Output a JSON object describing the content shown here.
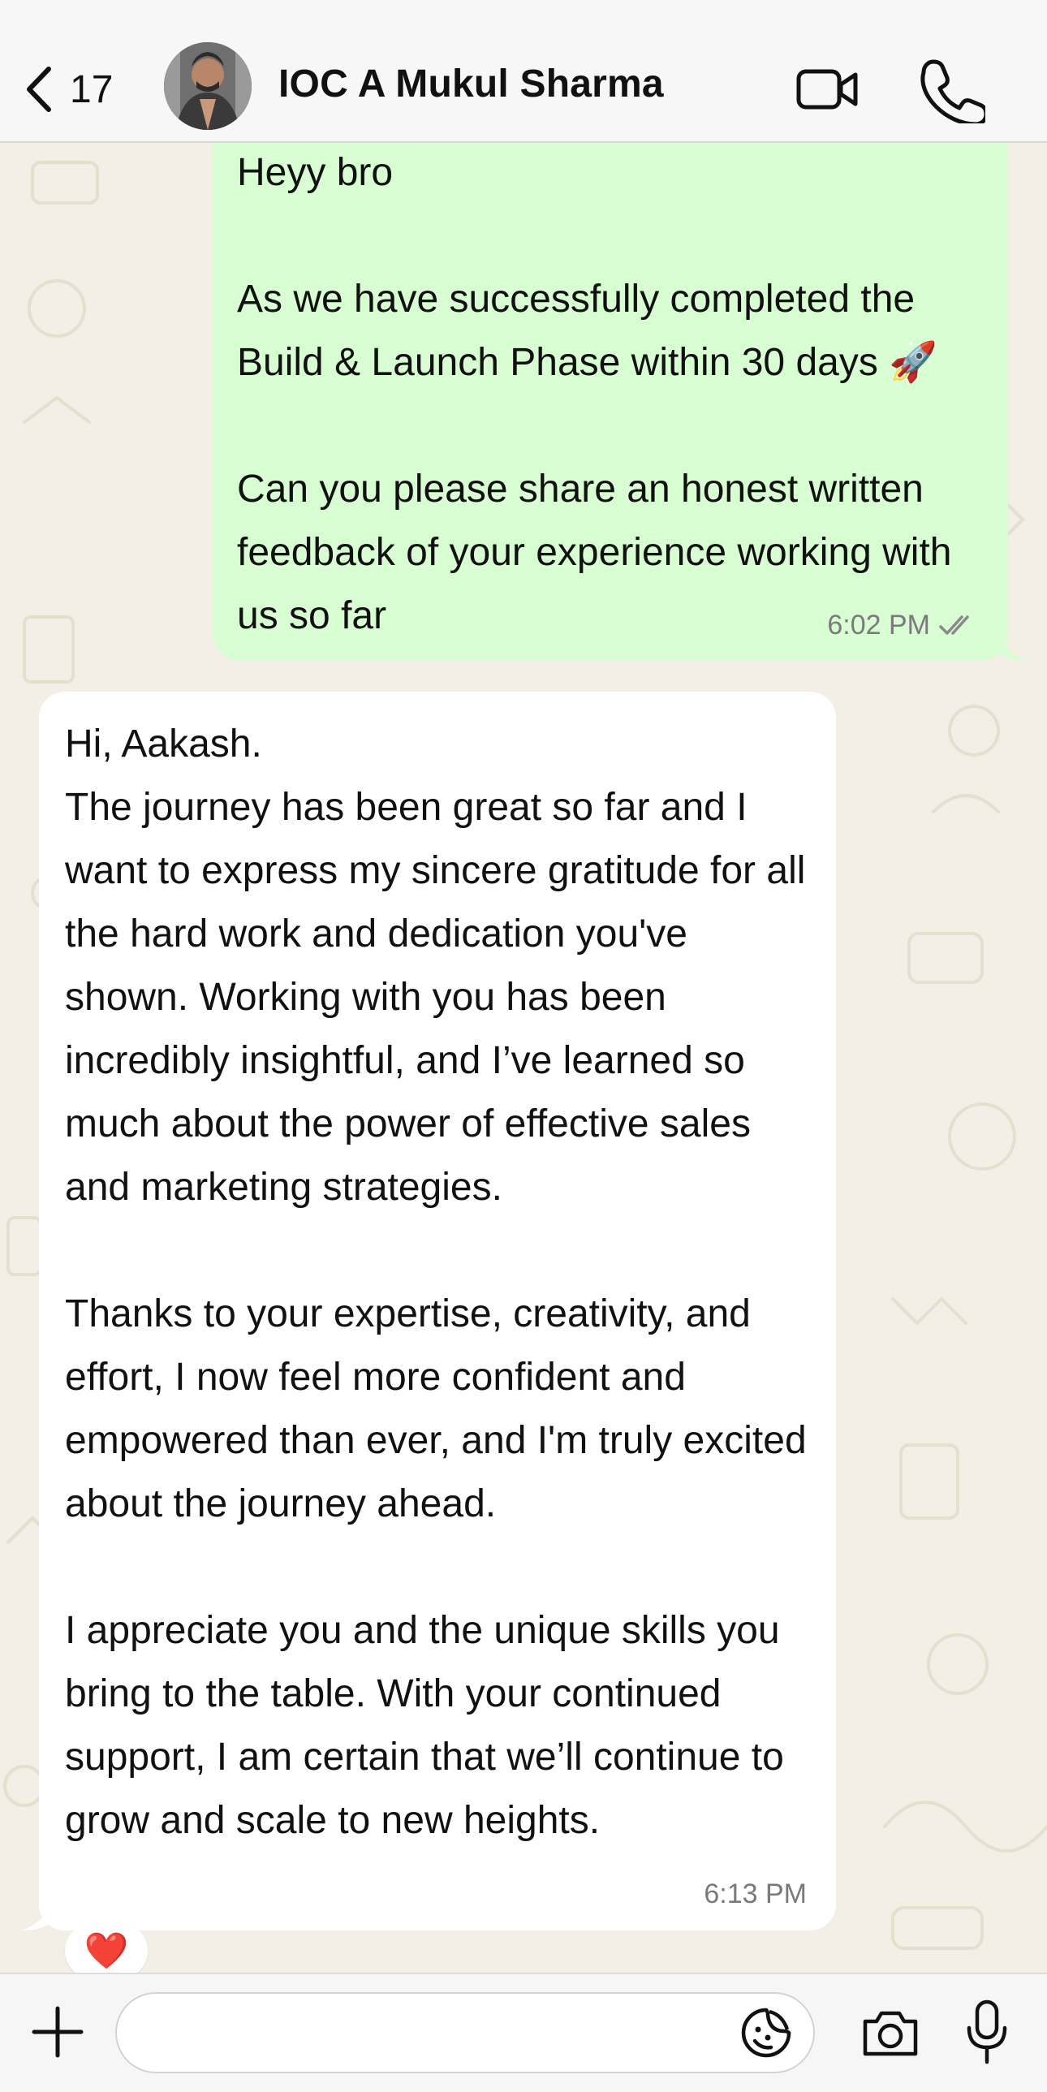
{
  "header": {
    "back_count": "17",
    "contact_name": "IOC A Mukul Sharma",
    "icons": [
      "chevron-left-icon",
      "video-call-icon",
      "phone-icon"
    ]
  },
  "messages": [
    {
      "direction": "outgoing",
      "paragraphs": [
        "Heyy bro",
        "As we have successfully completed the Build & Launch Phase within 30 days 🚀",
        "Can you please share an honest written feedback of your experience working with us so far"
      ],
      "time": "6:02 PM",
      "status": "read"
    },
    {
      "direction": "incoming",
      "paragraphs": [
        "Hi, Aakash.\nThe journey has been great so far and I want to express my sincere gratitude for all the hard work and dedication you've shown. Working with you has been incredibly insightful, and I’ve learned so much about the power of effective sales and marketing strategies.",
        "Thanks to your expertise, creativity, and effort, I now feel more confident and empowered than ever, and I'm truly excited about the journey ahead.",
        "I appreciate you and the unique skills you bring to the table. With your continued support, I am certain that we’ll continue to grow and scale to new heights."
      ],
      "time": "6:13 PM",
      "reaction": "❤️"
    }
  ],
  "composer": {
    "value": "",
    "icons": [
      "plus-icon",
      "sticker-icon",
      "camera-icon",
      "microphone-icon"
    ]
  },
  "colors": {
    "outgoing_bubble": "#d8fdd2",
    "incoming_bubble": "#ffffff",
    "chat_background": "#f3efe6",
    "read_ticks": "#8a8a8a"
  }
}
